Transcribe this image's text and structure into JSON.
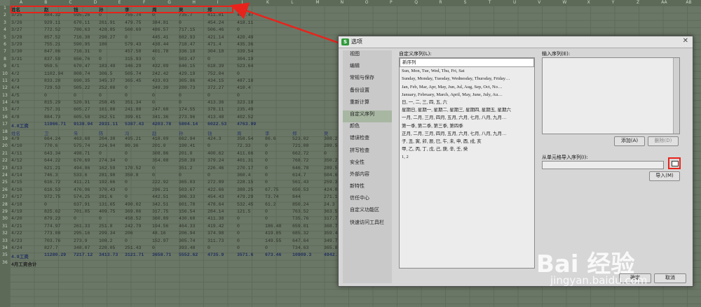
{
  "sheet": {
    "columns": [
      "A",
      "B",
      "C",
      "D",
      "E",
      "F",
      "G",
      "H",
      "I",
      "J",
      "K",
      "L",
      "M",
      "N",
      "O",
      "P",
      "Q",
      "R",
      "S",
      "T",
      "U",
      "V",
      "W",
      "X",
      "Y",
      "Z",
      "AA",
      "AB"
    ],
    "rows": [
      {
        "n": "1",
        "style": "bold",
        "c": [
          "姓名",
          "赵",
          "钱",
          "孙",
          "李",
          "周",
          "吴",
          "郑",
          "王"
        ]
      },
      {
        "n": "2",
        "c": [
          "3/25",
          "884.32",
          "595.26",
          "0",
          "755.74",
          "0",
          "735.7",
          "411.81",
          "483.47"
        ]
      },
      {
        "n": "3",
        "c": [
          "3/26",
          "929.11",
          "670.11",
          "261.91",
          "479.75",
          "384.81",
          "0",
          "454.24",
          "418.11"
        ]
      },
      {
        "n": "4",
        "c": [
          "3/27",
          "772.52",
          "786.63",
          "428.85",
          "560.69",
          "486.57",
          "717.15",
          "506.46",
          "0"
        ]
      },
      {
        "n": "5",
        "c": [
          "3/28",
          "857.52",
          "716.38",
          "290.27",
          "0",
          "445.41",
          "682.93",
          "421.14",
          "420.49"
        ]
      },
      {
        "n": "6",
        "c": [
          "3/29",
          "755.21",
          "590.95",
          "180",
          "579.43",
          "438.44",
          "718.47",
          "471.4",
          "435.36"
        ]
      },
      {
        "n": "7",
        "c": [
          "3/30",
          "847.06",
          "716.31",
          "0",
          "457.58",
          "401.78",
          "336.18",
          "304.18",
          "339.54"
        ]
      },
      {
        "n": "8",
        "c": [
          "3/31",
          "837.59",
          "656.76",
          "0",
          "315.93",
          "0",
          "503.47",
          "0",
          "304.19"
        ]
      },
      {
        "n": "9",
        "c": [
          "4/1",
          "959.5",
          "670.47",
          "183.49",
          "346.29",
          "432.09",
          "646.15",
          "618.39",
          "523.64"
        ]
      },
      {
        "n": "10",
        "c": [
          "4/2",
          "1102.94",
          "808.74",
          "306.5",
          "505.74",
          "242.42",
          "429.19",
          "752.04",
          "0"
        ]
      },
      {
        "n": "11",
        "c": [
          "4/3",
          "833.28",
          "690.35",
          "345.37",
          "365.45",
          "433.03",
          "305.86",
          "434.15",
          "487.18"
        ]
      },
      {
        "n": "12",
        "c": [
          "4/4",
          "729.53",
          "505.22",
          "252.08",
          "0",
          "349.39",
          "280.73",
          "372.27",
          "410.4"
        ]
      },
      {
        "n": "13",
        "c": [
          "4/5",
          "0",
          "0",
          "0",
          "0",
          "0",
          "0",
          "0",
          "0"
        ]
      },
      {
        "n": "14",
        "c": [
          "4/6",
          "815.29",
          "520.91",
          "258.45",
          "351.34",
          "0",
          "0",
          "413.36",
          "323.18"
        ]
      },
      {
        "n": "15",
        "c": [
          "4/7",
          "757.31",
          "605.27",
          "161.88",
          "241.88",
          "247.68",
          "174.55",
          "378.11",
          "235.49"
        ]
      },
      {
        "n": "16",
        "c": [
          "4/8",
          "884.73",
          "605.58",
          "262.51",
          "399.61",
          "341.36",
          "273.96",
          "413.48",
          "402.52"
        ]
      },
      {
        "n": "17",
        "style": "tot",
        "c": [
          "4.8工资",
          "11966.71",
          "9138.94",
          "2931.11",
          "5387.43",
          "4203.78",
          "5804.14",
          "6022.53",
          "4763.99"
        ]
      },
      {
        "n": "18",
        "style": "blue",
        "c": [
          "姓名",
          "卫",
          "朱",
          "陈",
          "冯",
          "赵",
          "孙",
          "钱",
          "周",
          "李",
          "郑",
          "吴",
          "王"
        ]
      },
      {
        "n": "19",
        "c": [
          "4/9",
          "664.24",
          "463.68",
          "204.38",
          "495.21",
          "418.09",
          "662.94",
          "424.3",
          "358.54",
          "86.6",
          "523.02",
          "388.21",
          "342.95"
        ]
      },
      {
        "n": "20",
        "c": [
          "4/10",
          "770.6",
          "575.74",
          "224.94",
          "80.36",
          "201.0",
          "190.41",
          "0",
          "72.33",
          "0",
          "721.08",
          "289.55",
          "200.22"
        ]
      },
      {
        "n": "21",
        "c": [
          "4/11",
          "643.34",
          "498.71",
          "0",
          "0",
          "308.86",
          "201.0",
          "400.62",
          "411.66",
          "0",
          "662.72",
          "0",
          "421.28"
        ]
      },
      {
        "n": "22",
        "c": [
          "4/12",
          "644.22",
          "670.69",
          "274.34",
          "0",
          "354.08",
          "258.39",
          "379.24",
          "401.31",
          "0",
          "768.72",
          "350.2",
          "423.48"
        ]
      },
      {
        "n": "23",
        "c": [
          "4/13",
          "621.21",
          "494.86",
          "162.59",
          "170.52",
          "0",
          "351.2",
          "226.46",
          "270.17",
          "0",
          "646.78",
          "289.5",
          "229.6"
        ]
      },
      {
        "n": "24",
        "c": [
          "4/14",
          "746.3",
          "533.6",
          "281.98",
          "350.8",
          "0",
          "0",
          "0",
          "360.4",
          "0",
          "614.7",
          "504.66",
          "0"
        ]
      },
      {
        "n": "25",
        "c": [
          "4/15",
          "616.72",
          "411.21",
          "192.66",
          "0",
          "222.92",
          "365.03",
          "272.89",
          "228.15",
          "0",
          "561.43",
          "259.33",
          "246.81"
        ]
      },
      {
        "n": "26",
        "c": [
          "4/16",
          "616.53",
          "476.96",
          "370.43",
          "0",
          "296.21",
          "503.67",
          "422.66",
          "388.25",
          "67.75",
          "650.53",
          "424.03",
          "354.59"
        ]
      },
      {
        "n": "27",
        "c": [
          "4/17",
          "972.75",
          "574.25",
          "281.6",
          "0",
          "442.51",
          "306.33",
          "454.43",
          "479.29",
          "T3.74",
          "844",
          "271.1",
          "347.18"
        ]
      },
      {
        "n": "28",
        "c": [
          "4/18",
          "0",
          "637.91",
          "131.65",
          "490.02",
          "342.51",
          "601.78",
          "478.64",
          "532.45",
          "61.2",
          "850.24",
          "24.3",
          "452.21"
        ]
      },
      {
        "n": "29",
        "c": [
          "4/19",
          "825.62",
          "701.05",
          "409.75",
          "369.06",
          "317.75",
          "156.54",
          "284.14",
          "121.5",
          "0",
          "763.52",
          "363.52",
          "457.21"
        ]
      },
      {
        "n": "30",
        "c": [
          "4/20",
          "879.23",
          "0",
          "0",
          "458.52",
          "360.89",
          "430.68",
          "411.38",
          "0",
          "0",
          "T35.76",
          "317.76",
          "269.77"
        ]
      },
      {
        "n": "31",
        "c": [
          "4/21",
          "774.97",
          "261.33",
          "251.8",
          "242.79",
          "194.56",
          "464.33",
          "419.42",
          "0",
          "186.48",
          "659.01",
          "368.72",
          "0"
        ]
      },
      {
        "n": "32",
        "c": [
          "4/22",
          "773.08",
          "295.16",
          "299.34",
          "206",
          "48.16",
          "206.94",
          "374.98",
          "0",
          "419.85",
          "685.32",
          "359.45",
          "0"
        ]
      },
      {
        "n": "33",
        "c": [
          "4/23",
          "703.76",
          "273.9",
          "108.2",
          "0",
          "152.97",
          "305.74",
          "311.73",
          "0",
          "149.55",
          "647.64",
          "349.75",
          "0"
        ]
      },
      {
        "n": "34",
        "c": [
          "4/24",
          "827.7",
          "348.07",
          "220.05",
          "251.43",
          "0",
          "393.48",
          "0",
          "0",
          "0",
          "T34.63",
          "365.82",
          "0"
        ]
      },
      {
        "n": "35",
        "style": "tot",
        "c": [
          "4.9工资",
          "11280.29",
          "7217.12",
          "3413.73",
          "3121.71",
          "3658.71",
          "5552.62",
          "4735.9",
          "3571.6",
          "673.46",
          "10909.3",
          "4942.43",
          "3794.11"
        ]
      },
      {
        "n": "36",
        "style": "bold",
        "c": [
          "4月工资合计"
        ]
      }
    ]
  },
  "dialog": {
    "title": "选项",
    "logo": "S",
    "close": "✕",
    "nav": [
      "视图",
      "编辑",
      "常规与保存",
      "备份设置",
      "重新计算",
      "自定义序列",
      "颜色",
      "错误检查",
      "拼写检查",
      "安全性",
      "外部内容",
      "新特性",
      "信任中心",
      "自定义功能区",
      "快速访问工具栏"
    ],
    "selected_nav": "自定义序列",
    "custom_list_label": "自定义序列(L):",
    "custom_lists": [
      "新序列",
      "Sun, Mon, Tue, Wed, Thu, Fri, Sat",
      "Sunday, Monday, Tuesday, Wednesday, Thursday, Friday…",
      "Jan, Feb, Mar, Apr, May, Jun, Jul, Aug, Sep, Oct, No…",
      "January, February, March, April, May, June, July, Au…",
      "日, 一, 二, 三, 四, 五, 六",
      "星期日, 星期一, 星期二, 星期三, 星期四, 星期五, 星期六",
      "一月, 二月, 三月, 四月, 五月, 六月, 七月, 八月, 九月…",
      "第一季, 第二季, 第三季, 第四季",
      "正月, 二月, 三月, 四月, 五月, 六月, 七月, 八月, 九月…",
      "子, 丑, 寅, 卯, 辰, 巳, 午, 未, 申, 酉, 戌, 亥",
      "甲, 乙, 丙, 丁, 戊, 己, 庚, 辛, 壬, 癸",
      "1, 2"
    ],
    "input_label": "输入序列(E):",
    "add_button": "添加(A)",
    "delete_button": "删除(D)",
    "import_label": "从单元格导入序列(I):",
    "import_button": "导入(M)",
    "ok_button": "确定",
    "cancel_button": "取消"
  },
  "watermark": {
    "brand": "Bai 经验",
    "url": "jingyan.baidu.com"
  },
  "colors": {
    "highlight": "#e8231c",
    "selected_nav": "#a8b7a2"
  }
}
